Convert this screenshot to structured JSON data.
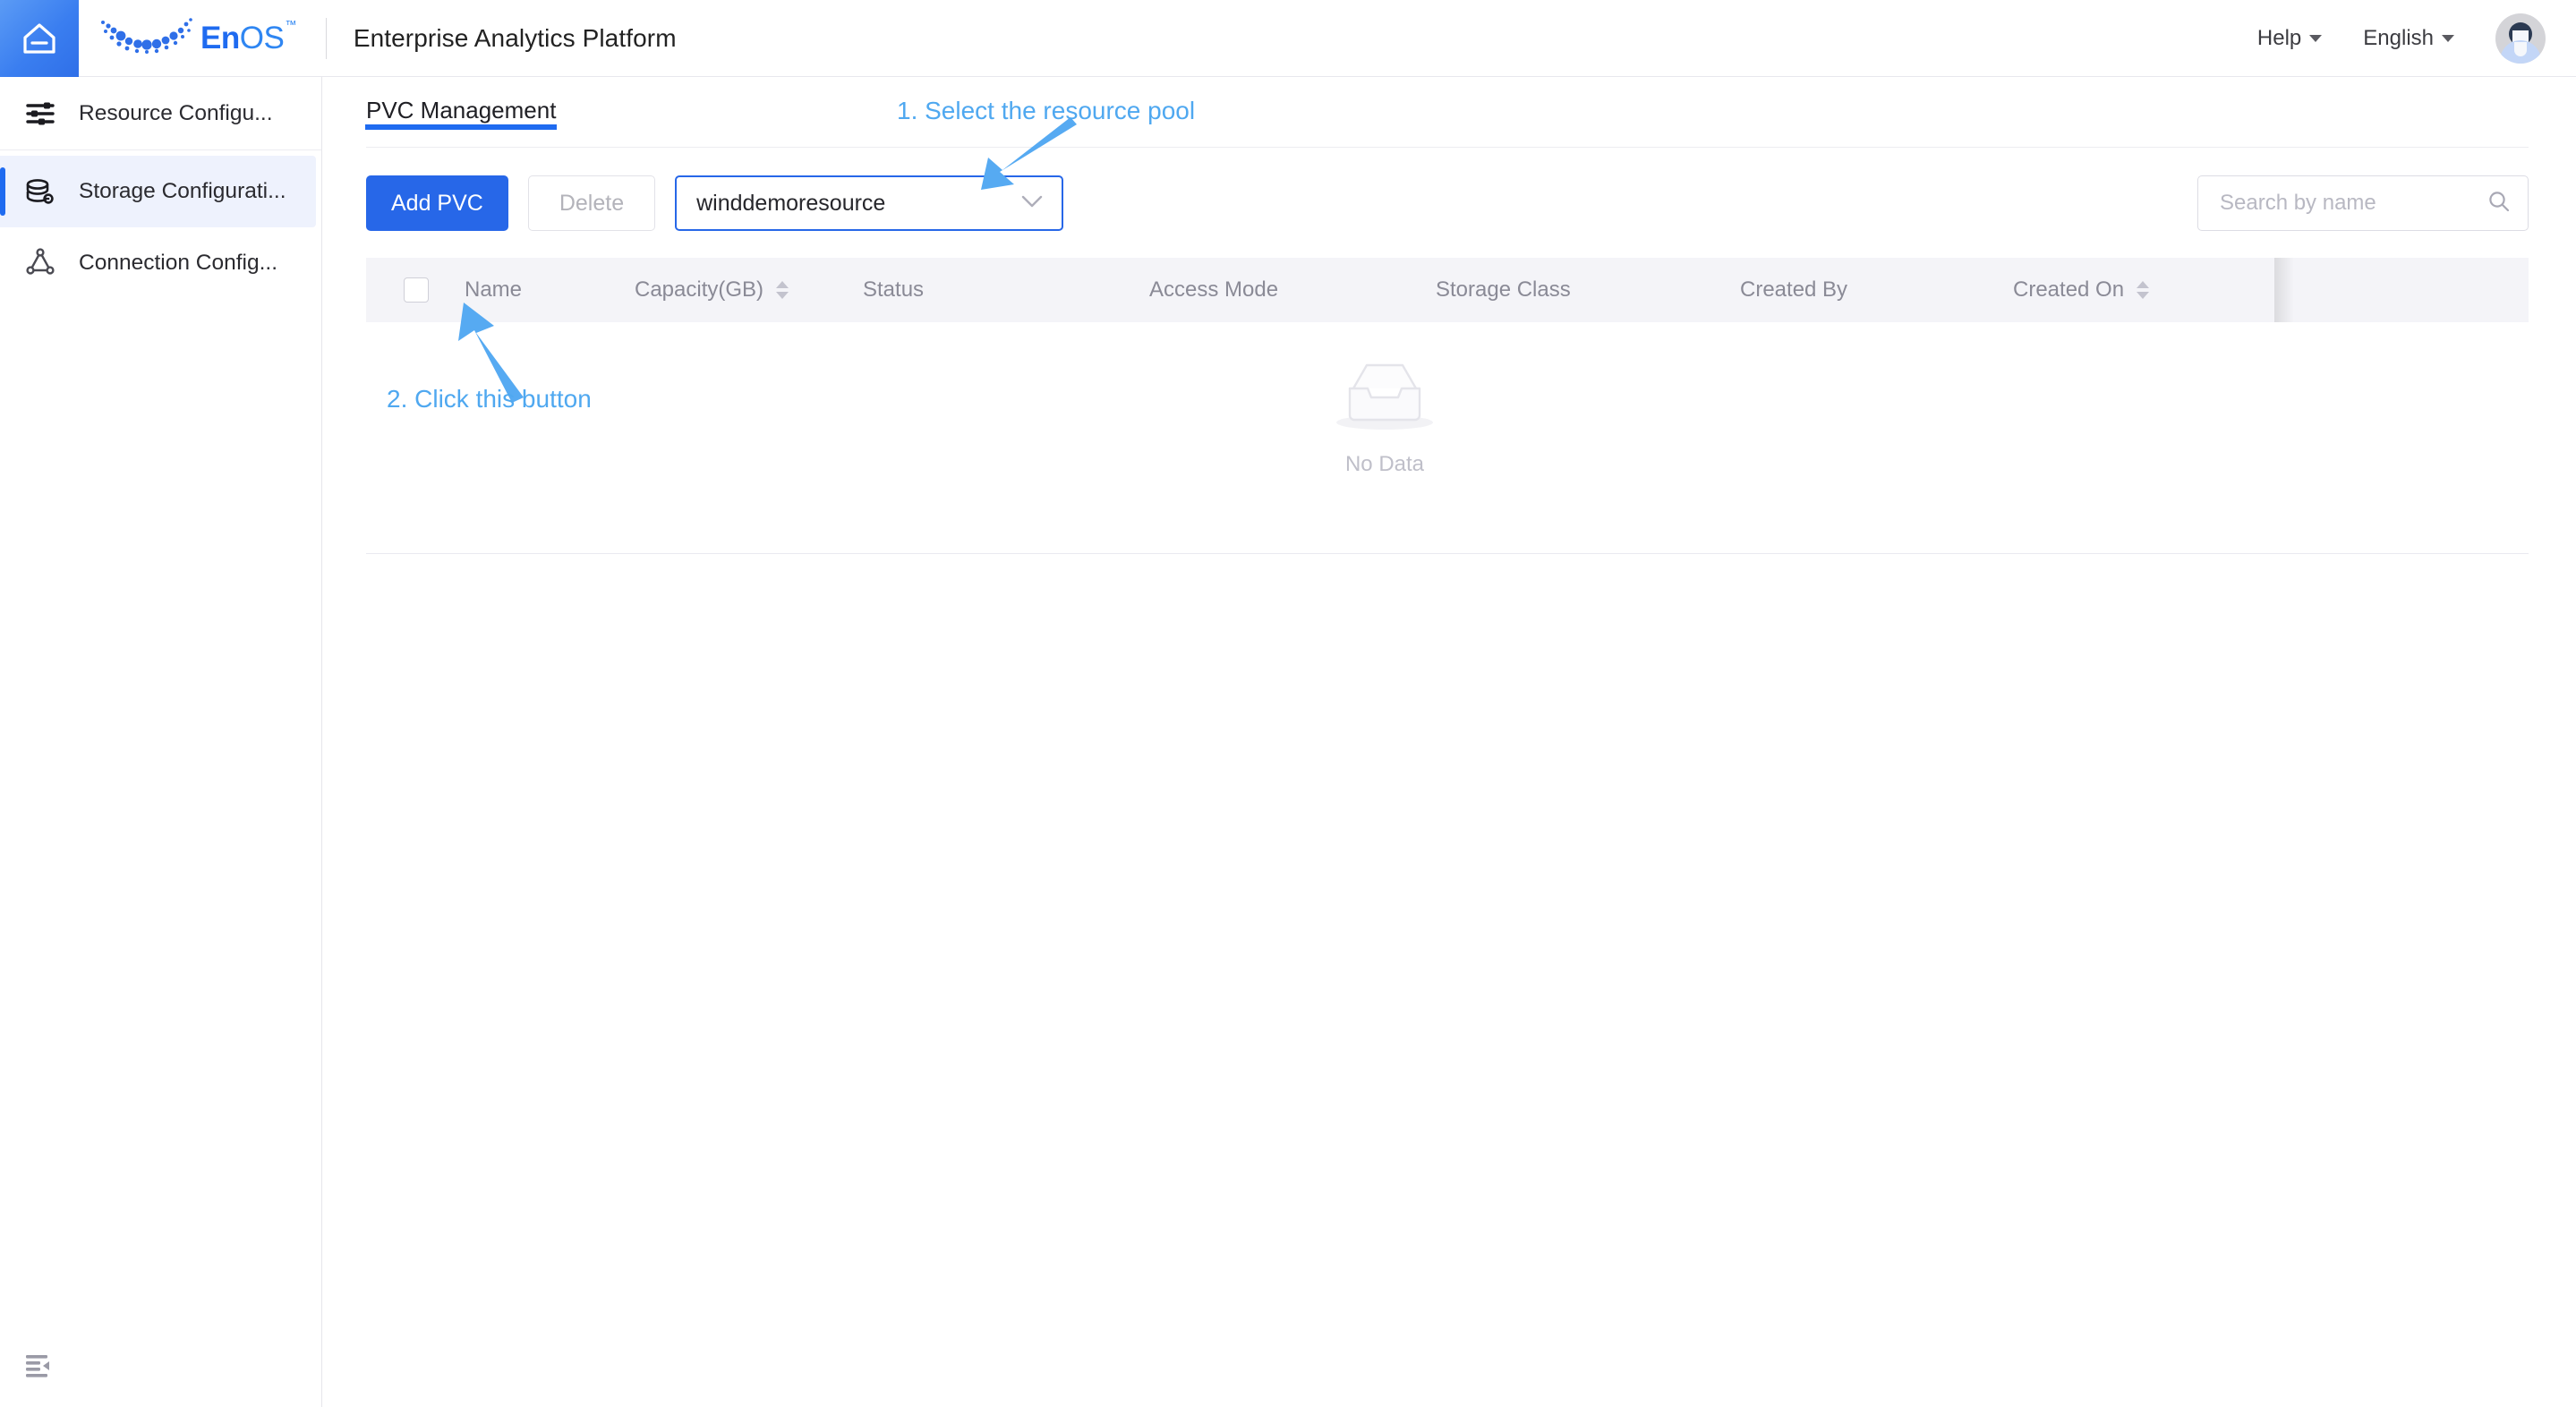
{
  "header": {
    "home_icon": "home-icon",
    "brand": {
      "logo_icon": "enos-dots-logo-icon",
      "word_en": "En",
      "word_os": "OS",
      "trademark": "™"
    },
    "app_title": "Enterprise Analytics Platform",
    "help_label": "Help",
    "language_label": "English",
    "avatar_icon": "user-avatar-icon"
  },
  "sidebar": {
    "items": [
      {
        "label": "Resource Configu...",
        "icon": "sliders-icon",
        "active": false
      },
      {
        "label": "Storage Configurati...",
        "icon": "database-stack-icon",
        "active": true
      },
      {
        "label": "Connection Config...",
        "icon": "connection-nodes-icon",
        "active": false
      }
    ],
    "collapse_icon": "menu-fold-icon"
  },
  "main": {
    "tabs": [
      {
        "label": "PVC Management",
        "active": true
      }
    ],
    "toolbar": {
      "add_label": "Add PVC",
      "delete_label": "Delete",
      "resource_pool_value": "winddemoresource",
      "resource_pool_caret": "chevron-down-icon"
    },
    "search": {
      "placeholder": "Search by name",
      "value": "",
      "icon": "search-icon"
    },
    "table": {
      "columns": [
        {
          "label": "",
          "key": "checkbox",
          "sortable": false
        },
        {
          "label": "Name",
          "key": "name",
          "sortable": false
        },
        {
          "label": "Capacity(GB)",
          "key": "capacity",
          "sortable": true
        },
        {
          "label": "Status",
          "key": "status",
          "sortable": false
        },
        {
          "label": "Access Mode",
          "key": "access_mode",
          "sortable": false
        },
        {
          "label": "Storage Class",
          "key": "storage_class",
          "sortable": false
        },
        {
          "label": "Created By",
          "key": "created_by",
          "sortable": false
        },
        {
          "label": "Created On",
          "key": "created_on",
          "sortable": true
        },
        {
          "label": "",
          "key": "actions",
          "sortable": false
        }
      ],
      "rows": [],
      "empty_text": "No Data",
      "empty_icon": "empty-inbox-icon"
    }
  },
  "annotations": [
    {
      "id": "anno-1",
      "text": "1. Select the resource pool",
      "arrow": "points down-left to resource pool select"
    },
    {
      "id": "anno-2",
      "text": "2. Click this button",
      "arrow": "points up-left to Add PVC button"
    }
  ],
  "colors": {
    "primary_blue": "#2767e8",
    "annotation_blue": "#4fa8f0",
    "sidebar_active_bg": "#eef2fd",
    "table_header_bg": "#f4f4f8"
  }
}
